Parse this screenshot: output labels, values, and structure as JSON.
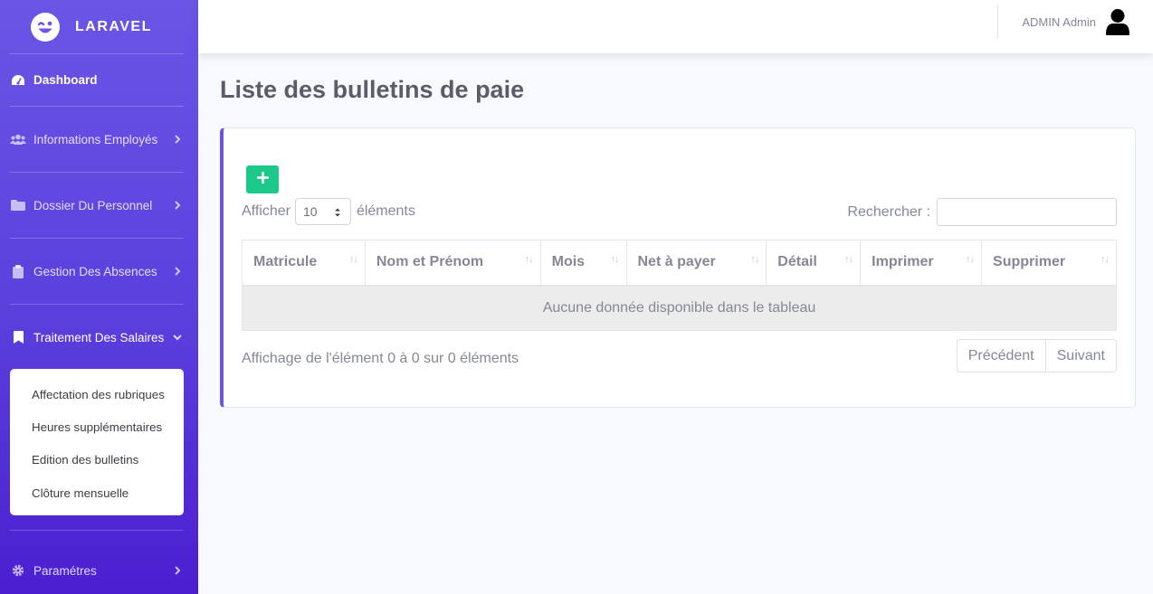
{
  "brand": {
    "name": "LARAVEL",
    "icon": "laugh-wink-icon"
  },
  "sidebar": {
    "dashboard": {
      "label": "Dashboard",
      "icon": "tachometer-icon"
    },
    "items": [
      {
        "label": "Informations Employés",
        "icon": "users-icon"
      },
      {
        "label": "Dossier Du Personnel",
        "icon": "folder-icon"
      },
      {
        "label": "Gestion Des Absences",
        "icon": "clipboard-icon"
      },
      {
        "label": "Traitement Des Salaires",
        "icon": "bookmark-icon"
      }
    ],
    "submenu": [
      {
        "label": "Affectation des rubriques"
      },
      {
        "label": "Heures supplémentaires"
      },
      {
        "label": "Edition des bulletins"
      },
      {
        "label": "Clôture mensuelle"
      }
    ],
    "settings": {
      "label": "Paramétres",
      "icon": "gear-icon"
    }
  },
  "topbar": {
    "user_name": "ADMIN Admin",
    "user_icon": "user-icon"
  },
  "page": {
    "title": "Liste des bulletins de paie"
  },
  "table_controls": {
    "length_prefix": "Afficher",
    "length_value": "10",
    "length_suffix": "éléments",
    "search_label": "Rechercher :",
    "search_value": ""
  },
  "table": {
    "columns": [
      "Matricule",
      "Nom et Prénom",
      "Mois",
      "Net à payer",
      "Détail",
      "Imprimer",
      "Supprimer"
    ],
    "empty_message": "Aucune donnée disponible dans le tableau"
  },
  "footer": {
    "info": "Affichage de l'élément 0 à 0 sur 0 éléments",
    "prev": "Précédent",
    "next": "Suivant"
  },
  "colors": {
    "sidebar_top": "#6a55e6",
    "sidebar_bottom": "#4b1fd0",
    "add_button": "#1cc88a",
    "card_accent": "#6a55e6"
  }
}
